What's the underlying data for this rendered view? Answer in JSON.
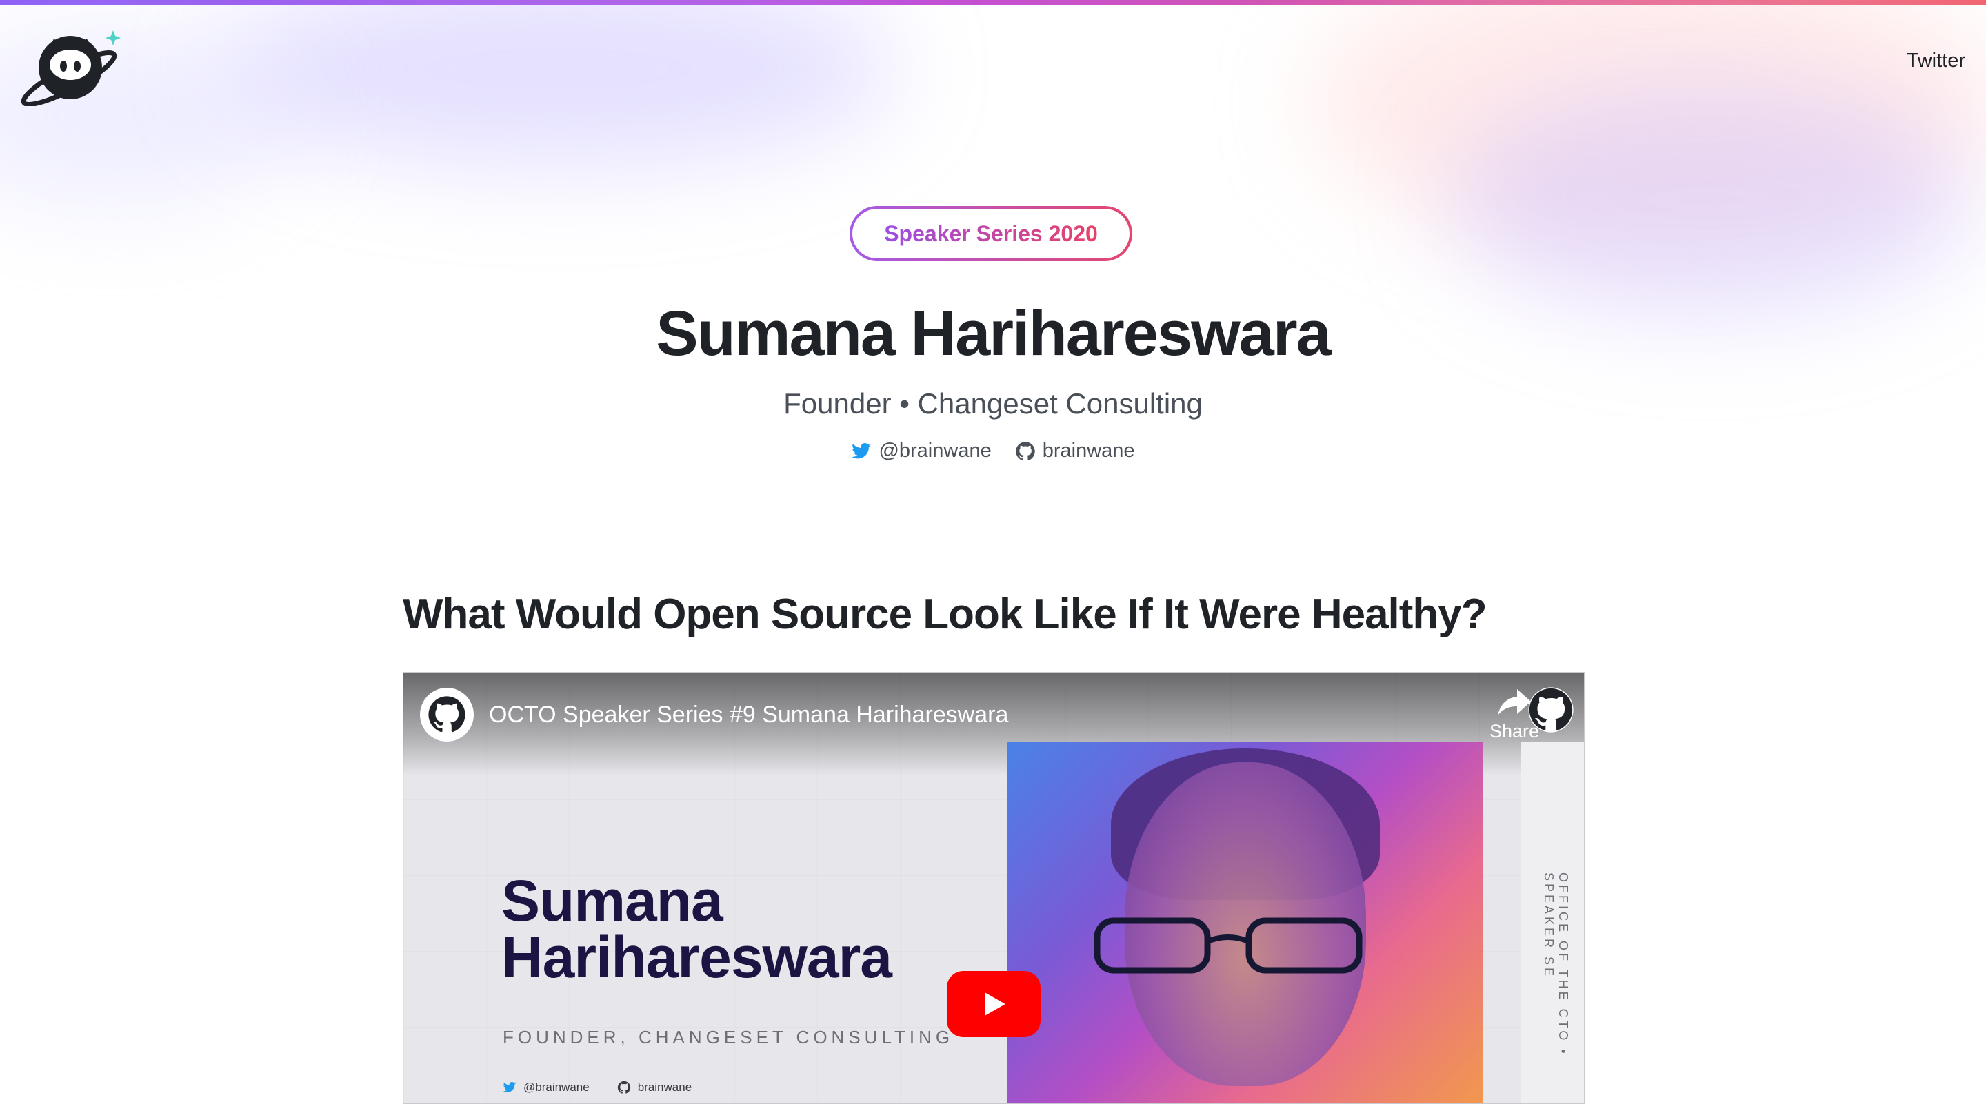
{
  "header": {
    "nav_twitter": "Twitter",
    "logo_icon": "octocat-astronaut-logo-icon"
  },
  "hero": {
    "badge": "Speaker Series 2020",
    "name": "Sumana Harihareswara",
    "role": "Founder • Changeset Consulting",
    "twitter_handle": "@brainwane",
    "github_handle": "brainwane"
  },
  "talk": {
    "title": "What Would Open Source Look Like If It Were Healthy?"
  },
  "video": {
    "title": "OCTO Speaker Series #9 Sumana Harihareswara",
    "share_label": "Share",
    "slide_name_line1": "Sumana",
    "slide_name_line2": "Harihareswara",
    "slide_role": "FOUNDER, CHANGESET CONSULTING",
    "slide_twitter": "@brainwane",
    "slide_github": "brainwane",
    "slide_side_text": "OFFICE OF THE CTO • SPEAKER SE"
  },
  "colors": {
    "accent_purple": "#9c4fe2",
    "accent_pink": "#e94166",
    "twitter_blue": "#1d9bf0",
    "youtube_red": "#ff0000"
  }
}
